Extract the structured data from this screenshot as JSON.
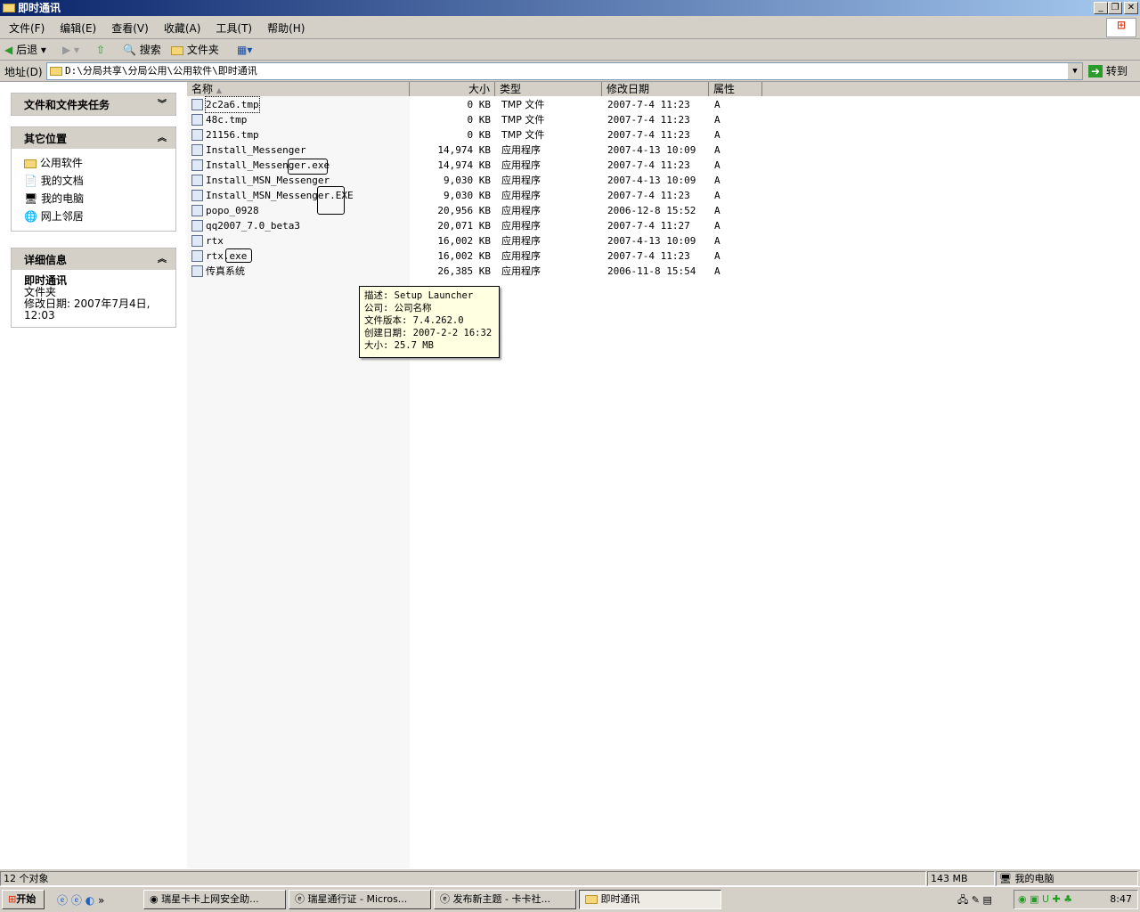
{
  "window": {
    "title": "即时通讯"
  },
  "menu": [
    "文件(F)",
    "编辑(E)",
    "查看(V)",
    "收藏(A)",
    "工具(T)",
    "帮助(H)"
  ],
  "toolbar": {
    "back": "后退",
    "search": "搜索",
    "folders": "文件夹"
  },
  "address": {
    "label": "地址(D)",
    "value": "D:\\分局共享\\分局公用\\公用软件\\即时通讯",
    "go": "转到"
  },
  "left": {
    "tasks_title": "文件和文件夹任务",
    "other_title": "其它位置",
    "other_items": [
      "公用软件",
      "我的文档",
      "我的电脑",
      "网上邻居"
    ],
    "details_title": "详细信息",
    "details_name": "即时通讯",
    "details_type": "文件夹",
    "details_modified": "修改日期: 2007年7月4日, 12:03"
  },
  "columns": [
    "名称",
    "大小",
    "类型",
    "修改日期",
    "属性"
  ],
  "files": [
    {
      "name": "2c2a6.tmp",
      "size": "0 KB",
      "type": "TMP 文件",
      "date": "2007-7-4 11:23",
      "attr": "A"
    },
    {
      "name": "48c.tmp",
      "size": "0 KB",
      "type": "TMP 文件",
      "date": "2007-7-4 11:23",
      "attr": "A"
    },
    {
      "name": "21156.tmp",
      "size": "0 KB",
      "type": "TMP 文件",
      "date": "2007-7-4 11:23",
      "attr": "A"
    },
    {
      "name": "Install_Messenger",
      "size": "14,974 KB",
      "type": "应用程序",
      "date": "2007-4-13 10:09",
      "attr": "A"
    },
    {
      "name": "Install_Messenger.exe",
      "size": "14,974 KB",
      "type": "应用程序",
      "date": "2007-7-4 11:23",
      "attr": "A"
    },
    {
      "name": "Install_MSN_Messenger",
      "size": "9,030 KB",
      "type": "应用程序",
      "date": "2007-4-13 10:09",
      "attr": "A"
    },
    {
      "name": "Install_MSN_Messenger.EXE",
      "size": "9,030 KB",
      "type": "应用程序",
      "date": "2007-7-4 11:23",
      "attr": "A"
    },
    {
      "name": "popo_0928",
      "size": "20,956 KB",
      "type": "应用程序",
      "date": "2006-12-8 15:52",
      "attr": "A"
    },
    {
      "name": "qq2007_7.0_beta3",
      "size": "20,071 KB",
      "type": "应用程序",
      "date": "2007-7-4 11:27",
      "attr": "A"
    },
    {
      "name": "rtx",
      "size": "16,002 KB",
      "type": "应用程序",
      "date": "2007-4-13 10:09",
      "attr": "A"
    },
    {
      "name": "rtx.exe",
      "size": "16,002 KB",
      "type": "应用程序",
      "date": "2007-7-4 11:23",
      "attr": "A"
    },
    {
      "name": "传真系统",
      "size": "26,385 KB",
      "type": "应用程序",
      "date": "2006-11-8 15:54",
      "attr": "A"
    }
  ],
  "tooltip": [
    "描述: Setup Launcher",
    "公司: 公司名称",
    "文件版本: 7.4.262.0",
    "创建日期: 2007-2-2 16:32",
    "大小: 25.7 MB"
  ],
  "status": {
    "count": "12 个对象",
    "size": "143 MB",
    "location": "我的电脑"
  },
  "taskbar": {
    "start": "开始",
    "more": "»",
    "tasks": [
      "瑞星卡卡上网安全助...",
      "瑞星通行证 - Micros...",
      "发布新主题 - 卡卡社...",
      "即时通讯"
    ],
    "clock": "8:47"
  }
}
